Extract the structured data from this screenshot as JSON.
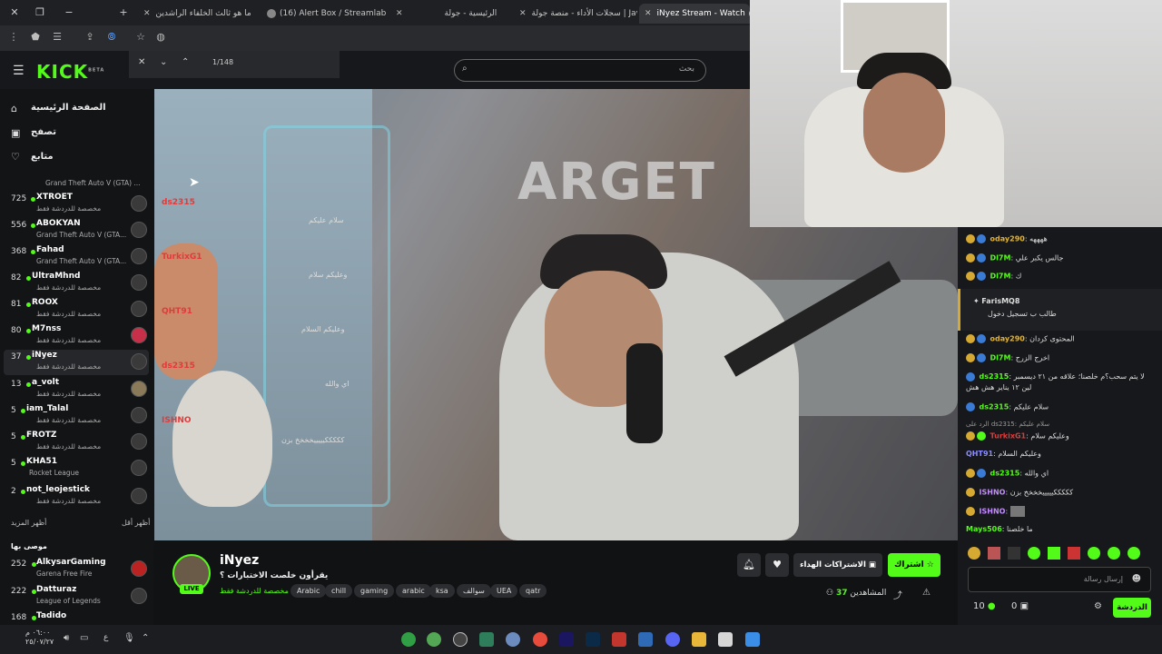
{
  "browser": {
    "tabs": [
      {
        "label": "ما هو ثالث الخلفاء الراشدين",
        "active": false
      },
      {
        "label": "(16) Alert Box / Streamlab",
        "active": false
      },
      {
        "label": "الرئيسية - جولة",
        "active": false
      },
      {
        "label": "سجلات الأداء - منصة جولة | Jawlah",
        "active": false
      },
      {
        "label": "iNyez Stream - Watch",
        "active": true
      }
    ],
    "find_count": "1/148"
  },
  "header": {
    "logo": "KICK",
    "logo_sup": "BETA",
    "search_placeholder": "بحث"
  },
  "sidebar": {
    "nav": [
      {
        "label": "الصفحة الرئيسية",
        "icon": "home-icon"
      },
      {
        "label": "تصفح",
        "icon": "browse-icon"
      },
      {
        "label": "متابع",
        "icon": "heart-icon"
      }
    ],
    "first_cat": "Grand Theft Auto V (GTA) ...",
    "channels": [
      {
        "count": "725",
        "name": "XTROET",
        "cat": "مخصصة للدردشة فقط"
      },
      {
        "count": "556",
        "name": "ABOKYAN",
        "cat": "Grand Theft Auto V (GTA..."
      },
      {
        "count": "368",
        "name": "Fahad",
        "cat": "Grand Theft Auto V (GTA..."
      },
      {
        "count": "82",
        "name": "UltraMhnd",
        "cat": "مخصصة للدردشة فقط"
      },
      {
        "count": "81",
        "name": "ROOX",
        "cat": "مخصصة للدردشة فقط"
      },
      {
        "count": "80",
        "name": "M7nss",
        "cat": "مخصصة للدردشة فقط"
      },
      {
        "count": "37",
        "name": "iNyez",
        "cat": "مخصصة للدردشة فقط"
      },
      {
        "count": "13",
        "name": "a_volt",
        "cat": "مخصصة للدردشة فقط"
      },
      {
        "count": "5",
        "name": "iam_Talal",
        "cat": "مخصصة للدردشة فقط"
      },
      {
        "count": "5",
        "name": "FROTZ",
        "cat": "مخصصة للدردشة فقط"
      },
      {
        "count": "5",
        "name": "KHA51",
        "cat": "Rocket League"
      },
      {
        "count": "2",
        "name": "not_leojestick",
        "cat": "مخصصة للدردشة فقط"
      }
    ],
    "show_more": "أظهر المزيد",
    "show_less": "أظهر أقل",
    "recommended_title": "موصى بها",
    "recommended": [
      {
        "count": "252",
        "name": "AlkysarGaming",
        "cat": "Garena Free Fire"
      },
      {
        "count": "222",
        "name": "Datturaz",
        "cat": "League of Legends"
      },
      {
        "count": "168",
        "name": "Tadido",
        "cat": ""
      }
    ]
  },
  "overlay_chat": [
    {
      "user": "ds2315",
      "msg": "سلام عليكم"
    },
    {
      "user": "TurkixG1",
      "msg": "وعليكم سلام"
    },
    {
      "user": "QHT91",
      "msg": "وعليكم السلام"
    },
    {
      "user": "ds2315",
      "msg": "اي والله"
    },
    {
      "user": "ISHNO",
      "msg": "كككككيييييخخخخ بزن"
    }
  ],
  "stream": {
    "channel": "iNyez",
    "live": "LIVE",
    "title": "يقرأون خلصت الاختبارات ؟",
    "category": "مخصصة للدردشة فقط",
    "tags": [
      "Arabic",
      "chill",
      "gaming",
      "arabic",
      "ksa",
      "سوالف",
      "UEA",
      "qatr"
    ],
    "subscribe": "اشتراك",
    "gift": "الاشتراكات الهداء",
    "viewers_label": "المشاهدين",
    "viewers": "37"
  },
  "chat": {
    "messages": [
      {
        "user": "oday290",
        "text": "ههههه",
        "color": "#e0b43a"
      },
      {
        "user": "Dl7M",
        "text": "جالس يكبر علي",
        "color": "#53fc18"
      },
      {
        "user": "Dl7M",
        "text": "ك",
        "color": "#53fc18"
      }
    ],
    "pinned_user": "FarisMQ8",
    "pinned_text": "طالب ب تسجيل دخول",
    "messages2": [
      {
        "user": "oday290",
        "text": "المحتوى كردان",
        "color": "#e0b43a"
      },
      {
        "user": "Dl7M",
        "text": "اخرج الزرج",
        "color": "#53fc18"
      },
      {
        "user": "ds2315",
        "text": "لا يتم سحب؟م خلصنا؛ علاقه من ٢١ ديسمبر لين ١٢ يناير هش هش",
        "color": "#53fc18"
      },
      {
        "user": "ds2315",
        "text": "سلام عليكم",
        "color": "#53fc18"
      },
      {
        "user": "ds2315",
        "text": "الرد على ds2315: سلام عليكم",
        "color": "#aaaaaa"
      },
      {
        "user": "TurkixG1",
        "text": "وعليكم سلام",
        "color": "#e23a3a"
      },
      {
        "user": "QHT91",
        "text": "وعليكم السلام",
        "color": "#8a8cff"
      },
      {
        "user": "ds2315",
        "text": "اي والله",
        "color": "#53fc18"
      },
      {
        "user": "ISHNO",
        "text": "كككككيييييخخخخ بزن",
        "color": "#c28cff"
      },
      {
        "user": "ISHNO",
        "text": "",
        "color": "#c28cff"
      },
      {
        "user": "Mays506",
        "text": "ما خلصنا",
        "color": "#53fc18"
      }
    ],
    "input_placeholder": "إرسال رسالة",
    "send": "الدردشة",
    "kicks": "10",
    "gifts": "0"
  },
  "taskbar": {
    "time": "٠٦:٠٠ م",
    "date": "٢٥/٠٧/٢٧"
  }
}
